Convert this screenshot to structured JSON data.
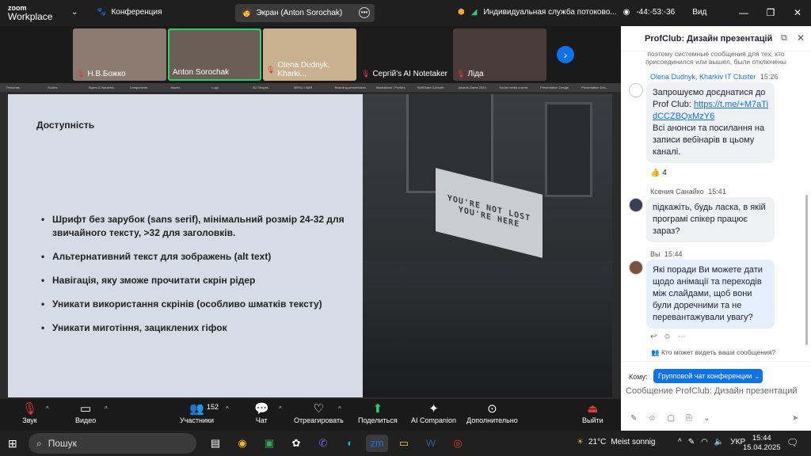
{
  "titlebar": {
    "logo_line1": "zoom",
    "logo_line2": "Workplace",
    "conference_label": "Конференция",
    "screen_label": "Экран (Anton Sorochak)",
    "service_label": "Индивидуальная служба потоково...",
    "timer": "-44:-53:-36",
    "view_label": "Вид"
  },
  "participants": [
    {
      "name": "Н.В.Божко",
      "muted": true,
      "color": "#8a7a70"
    },
    {
      "name": "Anton Sorochak",
      "muted": false,
      "color": "#6b5f55"
    },
    {
      "name": "Olena Dudnyk, Kharki...",
      "muted": true,
      "color": "#c9b18f"
    },
    {
      "name": "Сергій's AI Notetaker",
      "muted": true,
      "color": "#1c1c1c"
    },
    {
      "name": "Ліда",
      "muted": true,
      "color": "#4a3c3a"
    }
  ],
  "browser_tabs": [
    "Personas",
    "Guides",
    "Styles & Variables",
    "Components",
    "Assets",
    "Logo",
    "3D Shapes",
    "MENU / BAR",
    "Branding presentation",
    "Illustrations / Profiles",
    "SkillShare 3-Month",
    "Awards Game 2024",
    "Social media covers",
    "Presentation Design",
    "Presentation Des..."
  ],
  "slide": {
    "title": "Доступність",
    "bullets": [
      "Шрифт без зарубок (sans serif), мінімальний розмір 24-32 для звичайного тексту, >32 для заголовків.",
      "Альтернативний текст для зображень (alt text)",
      "Навігація, яку зможе прочитати скрін рідер",
      "Уникати використання скрінів (особливо шматків тексту)",
      "Уникати миготіння, зациклених гіфок"
    ],
    "sign_line1": "YOU'RE NOT LOST",
    "sign_line2": "YOU'RE HERE"
  },
  "chat": {
    "title": "ProfClub: Дизайн презентацій",
    "system_note": "поэтому системные сообщения для тех, кто присоединился или вышел, были отключены",
    "messages": [
      {
        "sender": "Olena Dudnyk, Kharkiv IT Cluster",
        "time": "15:26",
        "text_before": "Запрошуємо доєднатися до Prof Club: ",
        "link": "https://t.me/+M7aTidCCZBQxMzY6",
        "text_after": "Всі анонси та посилання на записи вебінарів  в цьому каналі.",
        "reaction": "4"
      },
      {
        "sender": "Ксения Санайко",
        "time": "15:41",
        "text": "підкажіть, будь ласка, в якій програмі спікер працює зараз?"
      },
      {
        "sender": "Вы",
        "time": "15:44",
        "text": "Які поради Ви можете дати щодо анімації та переходів між слайдами, щоб вони були доречними та не перевантажували увагу?"
      }
    ],
    "who_can_see": "Кто может видеть ваши сообщения?",
    "to_label": "Кому:",
    "to_value": "Групповой чат конференции",
    "input_placeholder": "Сообщение ProfClub: Дизайн презентаций"
  },
  "toolbar": {
    "audio": "Звук",
    "video": "Видео",
    "participants": "Участники",
    "participants_count": "152",
    "chat": "Чат",
    "react": "Отреагировать",
    "share": "Поделиться",
    "ai": "AI Companion",
    "more": "Дополнительно",
    "leave": "Выйти"
  },
  "taskbar": {
    "search": "Пошук",
    "weather_temp": "21°C",
    "weather_desc": "Meist sonnig",
    "lang": "УКР",
    "time": "15:44",
    "date": "15.04.2025"
  },
  "colors": {
    "zoom_blue": "#0e72ed",
    "active_speaker": "#27d36b",
    "muted_red": "#e53935"
  }
}
